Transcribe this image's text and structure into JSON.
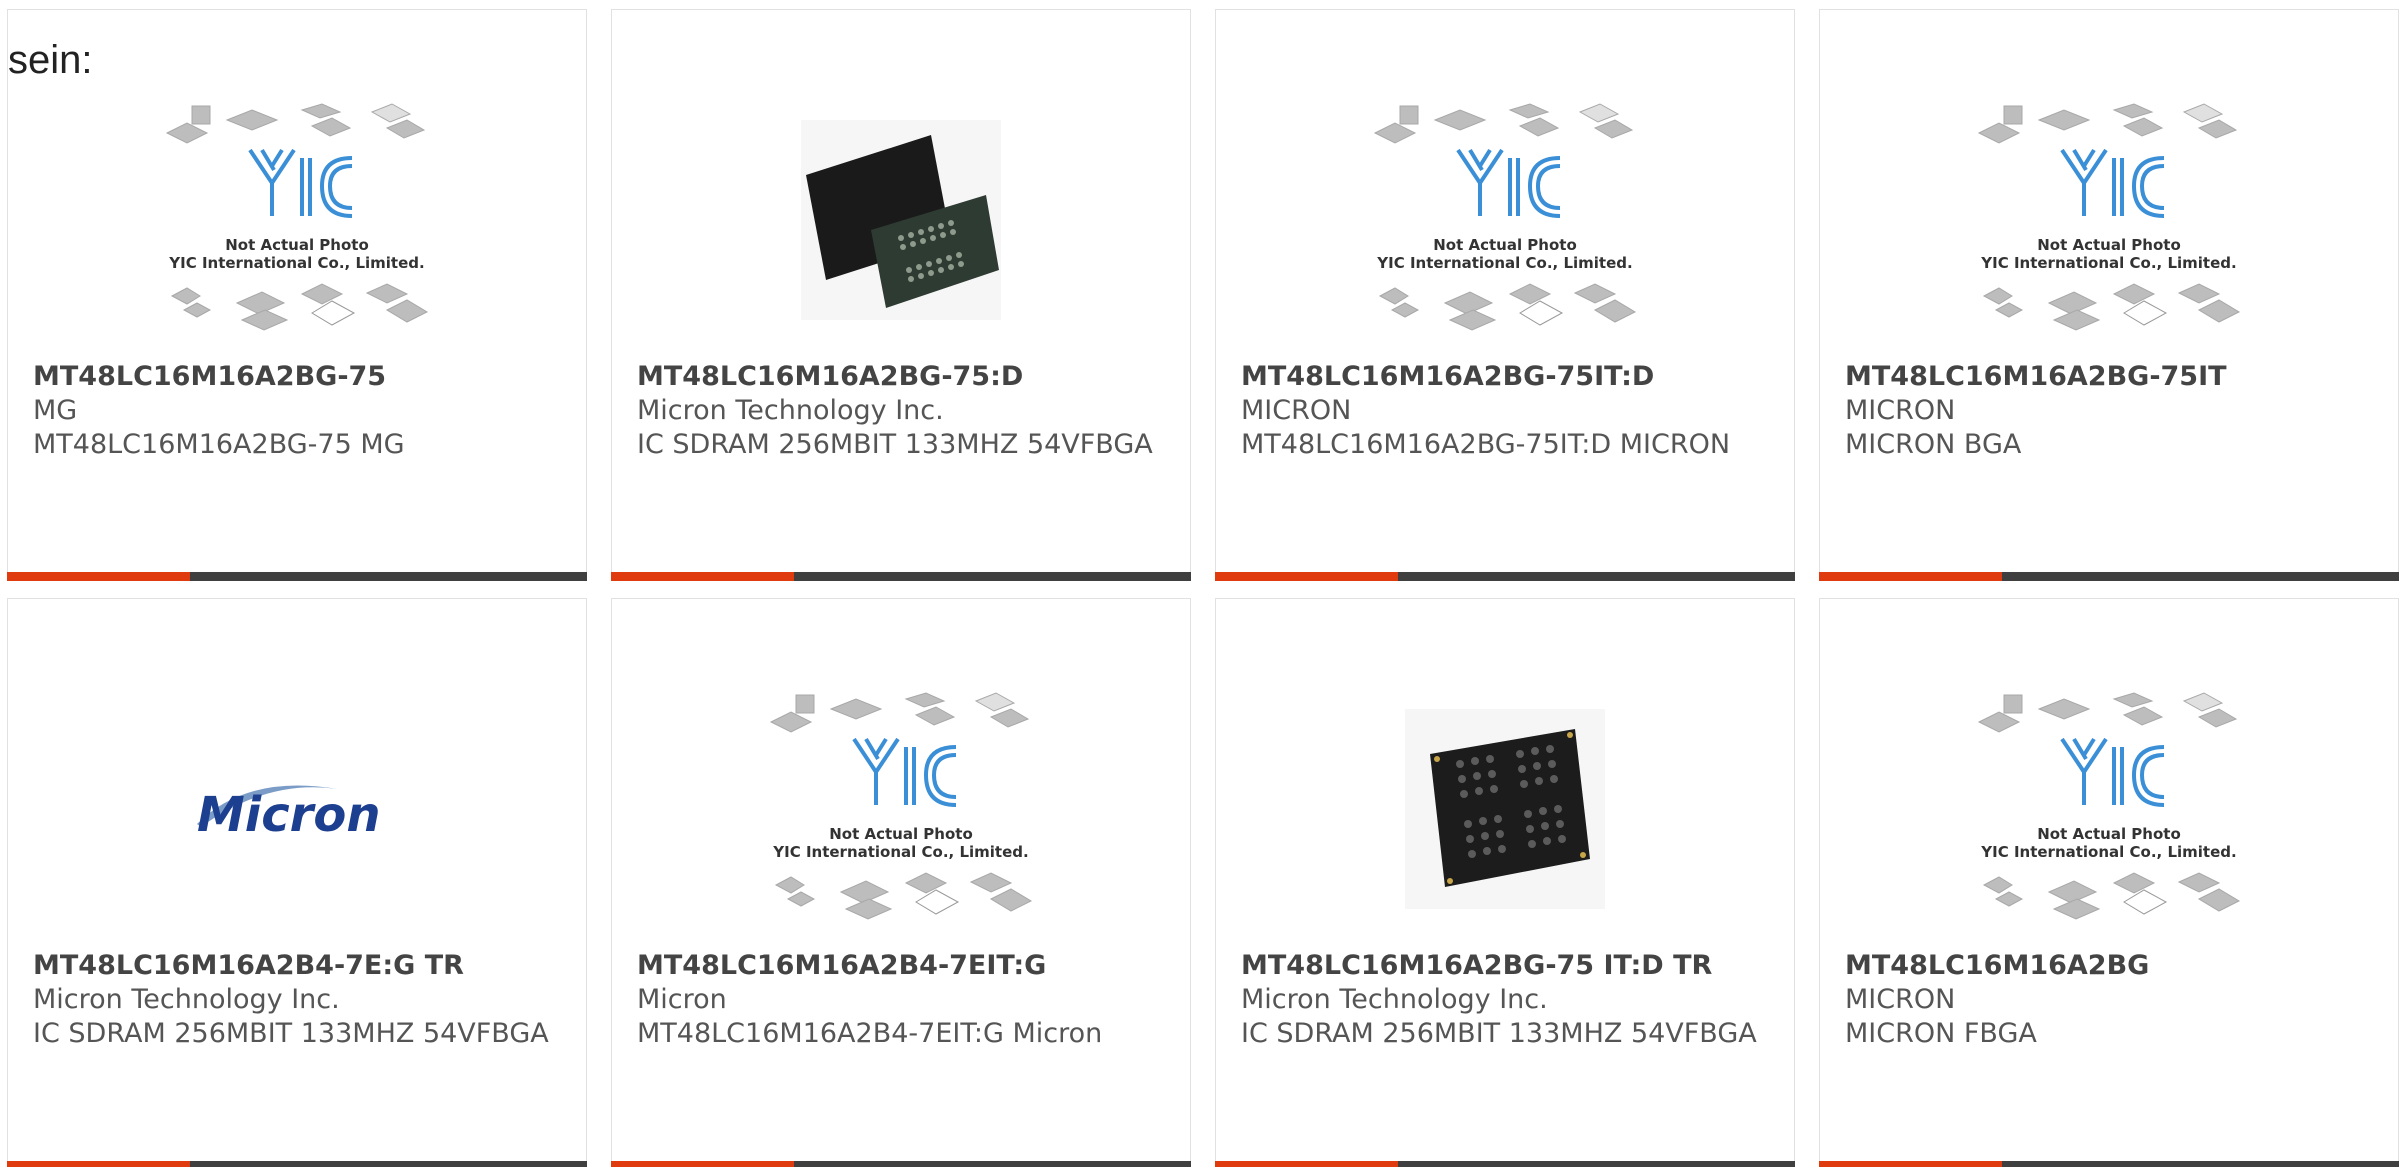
{
  "lead_text": "sein:",
  "placeholder_caption": {
    "line1": "Not Actual Photo",
    "line2": "YIC International Co., Limited.",
    "logo": "YIC"
  },
  "micron_logo_text": "Micron",
  "colors": {
    "accent": "#e03a0f",
    "bar": "#3f3f3f",
    "text": "#555555",
    "logo_blue": "#3a8fd6"
  },
  "products": [
    {
      "part": "MT48LC16M16A2BG-75",
      "maker": "MG",
      "desc": "MT48LC16M16A2BG-75 MG",
      "image": "placeholder-photo"
    },
    {
      "part": "MT48LC16M16A2BG-75:D",
      "maker": "Micron Technology Inc.",
      "desc": "IC SDRAM 256MBIT 133MHZ 54VFBGA",
      "image": "chip-photo-rect"
    },
    {
      "part": "MT48LC16M16A2BG-75IT:D",
      "maker": "MICRON",
      "desc": "MT48LC16M16A2BG-75IT:D MICRON",
      "image": "placeholder-photo"
    },
    {
      "part": "MT48LC16M16A2BG-75IT",
      "maker": "MICRON",
      "desc": "MICRON BGA",
      "image": "placeholder-photo"
    },
    {
      "part": "MT48LC16M16A2B4-7E:G TR",
      "maker": "Micron Technology Inc.",
      "desc": "IC SDRAM 256MBIT 133MHZ 54VFBGA",
      "image": "micron-logo"
    },
    {
      "part": "MT48LC16M16A2B4-7EIT:G",
      "maker": "Micron",
      "desc": "MT48LC16M16A2B4-7EIT:G Micron",
      "image": "placeholder-photo"
    },
    {
      "part": "MT48LC16M16A2BG-75 IT:D TR",
      "maker": "Micron Technology Inc.",
      "desc": "IC SDRAM 256MBIT 133MHZ 54VFBGA",
      "image": "chip-photo-bga"
    },
    {
      "part": "MT48LC16M16A2BG",
      "maker": "MICRON",
      "desc": "MICRON FBGA",
      "image": "placeholder-photo"
    }
  ]
}
